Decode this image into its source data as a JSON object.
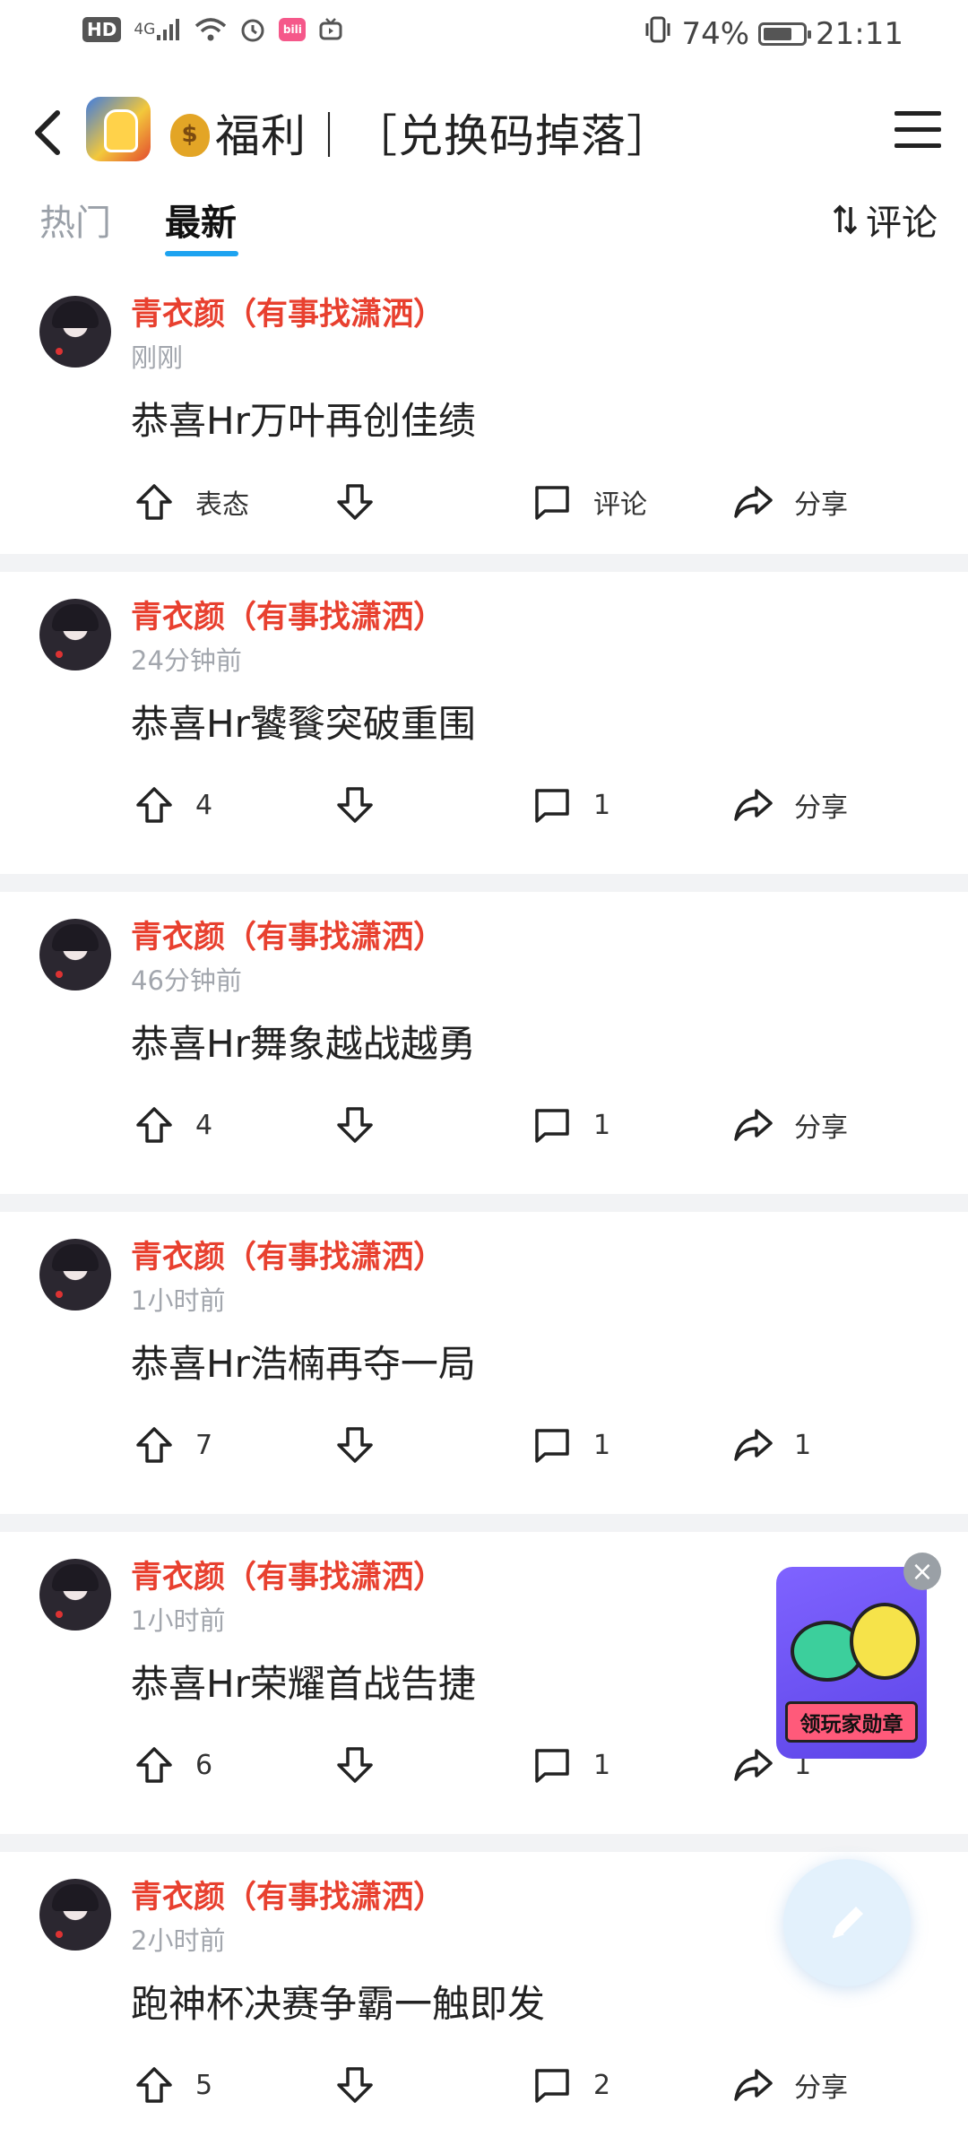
{
  "status_bar": {
    "hd": "HD",
    "network": "4G",
    "bili": "bili",
    "battery_text": "74%",
    "battery_level": 0.74,
    "time": "21:11"
  },
  "header": {
    "title": "福利｜［兑换码掉落］"
  },
  "tabs": {
    "hot": "热门",
    "latest": "最新",
    "active": "latest",
    "sort_label": "评论"
  },
  "posts": [
    {
      "user": "青衣颜（有事找潇洒）",
      "time": "刚刚",
      "content": "恭喜Hr万叶再创佳绩",
      "up": "表态",
      "comment": "评论",
      "share": "分享"
    },
    {
      "user": "青衣颜（有事找潇洒）",
      "time": "24分钟前",
      "content": "恭喜Hr饕餮突破重围",
      "up": "4",
      "comment": "1",
      "share": "分享"
    },
    {
      "user": "青衣颜（有事找潇洒）",
      "time": "46分钟前",
      "content": "恭喜Hr舞象越战越勇",
      "up": "4",
      "comment": "1",
      "share": "分享"
    },
    {
      "user": "青衣颜（有事找潇洒）",
      "time": "1小时前",
      "content": "恭喜Hr浩楠再夺一局",
      "up": "7",
      "comment": "1",
      "share": "1"
    },
    {
      "user": "青衣颜（有事找潇洒）",
      "time": "1小时前",
      "content": "恭喜Hr荣耀首战告捷",
      "up": "6",
      "comment": "1",
      "share": "1"
    },
    {
      "user": "青衣颜（有事找潇洒）",
      "time": "2小时前",
      "content": "跑神杯决赛争霸一触即发",
      "up": "5",
      "comment": "2",
      "share": "分享"
    }
  ],
  "floating": {
    "badge_label": "领玩家勋章"
  },
  "colors": {
    "username": "#e8402f",
    "tab_underline": "#1da3f0",
    "separator": "#f2f3f5"
  }
}
